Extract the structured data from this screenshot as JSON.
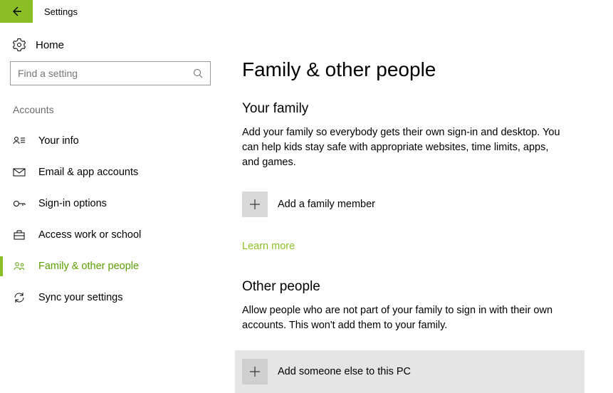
{
  "window": {
    "title": "Settings"
  },
  "sidebar": {
    "home_label": "Home",
    "search_placeholder": "Find a setting",
    "category": "Accounts",
    "items": [
      {
        "label": "Your info",
        "icon": "person-card"
      },
      {
        "label": "Email & app accounts",
        "icon": "mail"
      },
      {
        "label": "Sign-in options",
        "icon": "key"
      },
      {
        "label": "Access work or school",
        "icon": "briefcase"
      },
      {
        "label": "Family & other people",
        "icon": "people"
      },
      {
        "label": "Sync your settings",
        "icon": "sync"
      }
    ]
  },
  "main": {
    "heading": "Family & other people",
    "family": {
      "title": "Your family",
      "description": "Add your family so everybody gets their own sign-in and desktop. You can help kids stay safe with appropriate websites, time limits, apps, and games.",
      "add_label": "Add a family member",
      "learn_more": "Learn more"
    },
    "others": {
      "title": "Other people",
      "description": "Allow people who are not part of your family to sign in with their own accounts. This won't add them to your family.",
      "add_label": "Add someone else to this PC"
    }
  },
  "colors": {
    "accent": "#8cbf26"
  }
}
